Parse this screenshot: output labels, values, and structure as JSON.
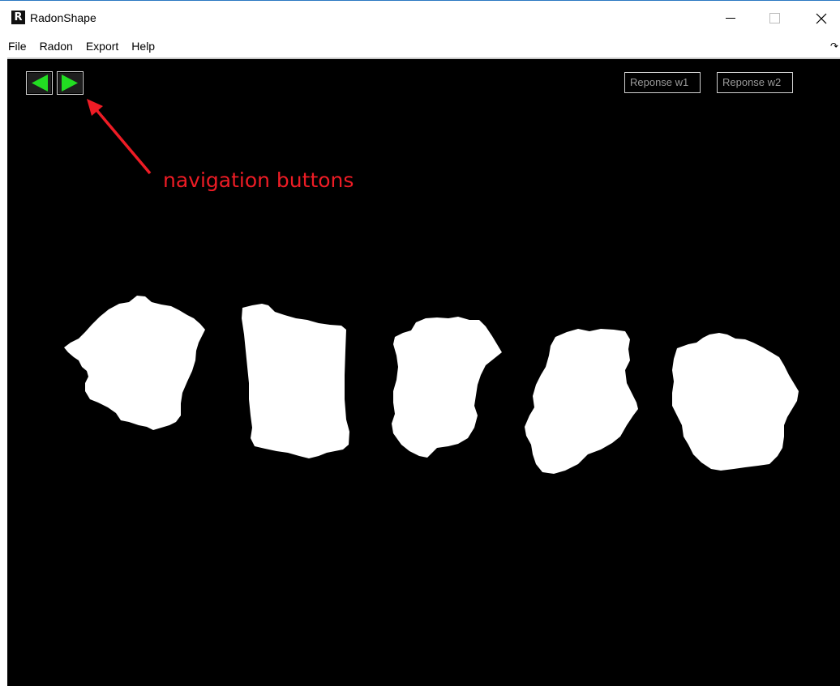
{
  "window": {
    "title": "RadonShape",
    "icon_letter": "R",
    "controls": {
      "minimize": "minimize",
      "maximize": "maximize",
      "close": "✕"
    }
  },
  "menu": {
    "items": [
      "File",
      "Radon",
      "Export",
      "Help"
    ],
    "corner_glyph": "↷"
  },
  "toolbar": {
    "response_w1": "Reponse w1",
    "response_w2": "Reponse w2",
    "nav_button_color": "#22dd22"
  },
  "annotation": {
    "text": "navigation buttons",
    "color": "#ee1c25"
  },
  "canvas": {
    "background": "#000000",
    "shape_color": "#ffffff",
    "shapes": [
      "particle-1",
      "particle-2",
      "particle-3",
      "particle-4",
      "particle-5"
    ]
  }
}
